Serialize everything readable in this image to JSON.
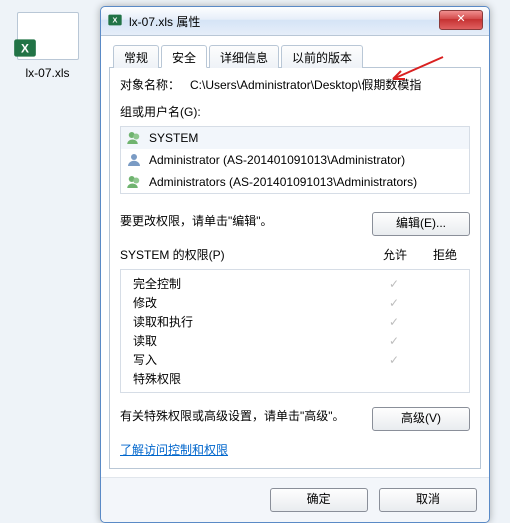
{
  "desktop": {
    "file_name": "lx-07.xls"
  },
  "dialog": {
    "title": "lx-07.xls 属性",
    "tabs": {
      "general": "常规",
      "security": "安全",
      "details": "详细信息",
      "previous": "以前的版本"
    },
    "object_label": "对象名称：",
    "object_path": "C:\\Users\\Administrator\\Desktop\\假期数模指",
    "group_label": "组或用户名(G):",
    "users": {
      "system": "SYSTEM",
      "admin": "Administrator (AS-201401091013\\Administrator)",
      "admins": "Administrators (AS-201401091013\\Administrators)"
    },
    "edit_note": "要更改权限，请单击\"编辑\"。",
    "edit_btn": "编辑(E)...",
    "perm_header": "SYSTEM 的权限(P)",
    "allow": "允许",
    "deny": "拒绝",
    "perms": {
      "full": "完全控制",
      "modify": "修改",
      "readexec": "读取和执行",
      "read": "读取",
      "write": "写入",
      "special": "特殊权限"
    },
    "adv_note": "有关特殊权限或高级设置，请单击\"高级\"。",
    "adv_btn": "高级(V)",
    "link": "了解访问控制和权限",
    "ok": "确定",
    "cancel": "取消"
  }
}
